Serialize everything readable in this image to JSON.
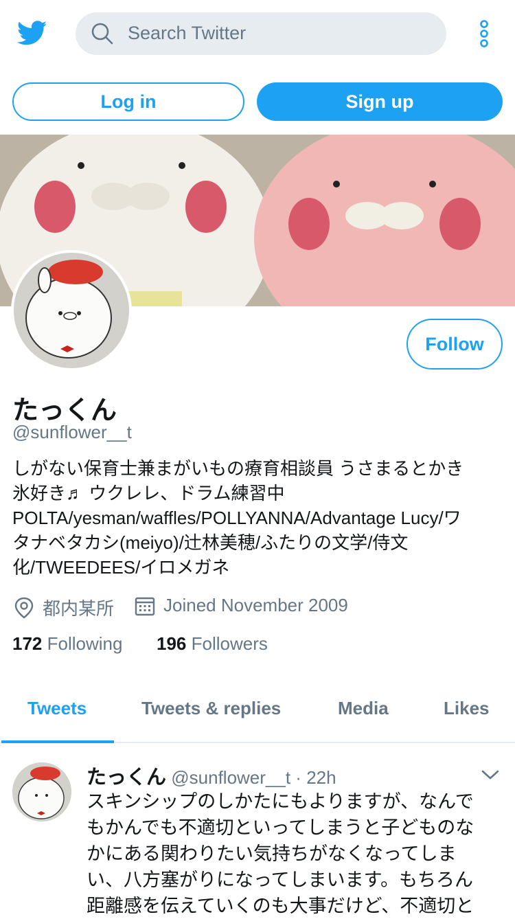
{
  "topbar": {
    "logo": "twitter-bird-icon",
    "search_placeholder": "Search Twitter",
    "more": "more-vertical-icon"
  },
  "auth": {
    "login_label": "Log in",
    "signup_label": "Sign up"
  },
  "profile": {
    "name": "たっくん",
    "handle": "@sunflower__t",
    "follow_label": "Follow",
    "bio_lines": [
      "しがない保育士兼まがいもの療育相談員 うさまるとかき",
      "氷好き♬ ウクレレ、ドラム練習中",
      "POLTA/yesman/waffles/POLLYANNA/Advantage Lucy/ワ",
      "タナベタカシ(meiyo)/辻林美穂/ふたりの文学/侍文",
      "化/TWEEDEES/イロメガネ"
    ],
    "location": "都内某所",
    "joined": "Joined November 2009",
    "following_count": "172",
    "following_label": "Following",
    "followers_count": "196",
    "followers_label": "Followers"
  },
  "tabs": [
    {
      "label": "Tweets",
      "active": true
    },
    {
      "label": "Tweets & replies",
      "active": false
    },
    {
      "label": "Media",
      "active": false
    },
    {
      "label": "Likes",
      "active": false
    }
  ],
  "tweet": {
    "name": "たっくん",
    "handle": "@sunflower__t",
    "separator": "·",
    "time": "22h",
    "lines": [
      "スキンシップのしかたにもよりますが、なんで",
      "もかんでも不適切といってしまうと子どものな",
      "かにある関わりたい気持ちがなくなってしま",
      "い、八方塞がりになってしまいます。もちろん",
      "距離感を伝えていくのも大事だけど、不適切と"
    ]
  },
  "colors": {
    "accent": "#1da1f2",
    "muted": "#657786",
    "search_bg": "#e6ecf0"
  }
}
